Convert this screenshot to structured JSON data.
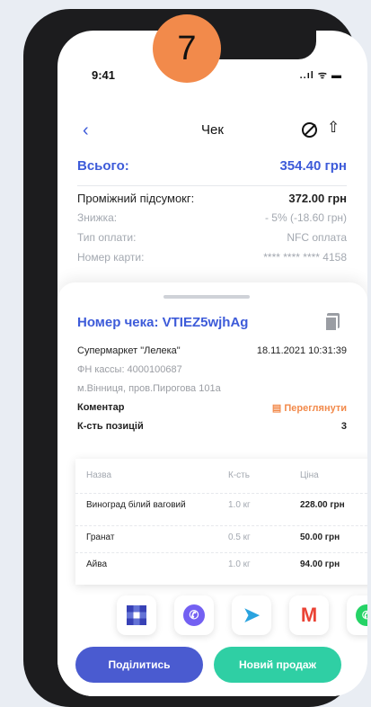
{
  "step_badge": "7",
  "status_bar": {
    "time": "9:41",
    "icons": "..ıl ᯤ ▬"
  },
  "nav": {
    "back_icon": "‹",
    "title": "Чек",
    "share_icon": "⇧"
  },
  "summary": {
    "total_label": "Всього:",
    "total_value": "354.40 грн",
    "subtotal_label": "Проміжний підсумокг:",
    "subtotal_value": "372.00 грн",
    "discount_label": "Знижка:",
    "discount_value": "- 5% (-18.60 грн)",
    "payment_label": "Тип оплати:",
    "payment_value": "NFC оплата",
    "card_label": "Номер карти:",
    "card_value": "**** **** **** 4158"
  },
  "receipt": {
    "title": "Номер чека: VTIEZ5wjhAg",
    "store": "Супермаркет \"Лелека\"",
    "datetime": "18.11.2021 10:31:39",
    "fiscal": "ФН кассы: 4000100687",
    "address": "м.Вінниця, пров.Пирогова 101а",
    "comment_label": "Коментар",
    "comment_action": "Переглянути",
    "positions_label": "К-сть позицій",
    "positions_value": "3"
  },
  "table": {
    "headers": [
      "Назва",
      "К-сть",
      "Ціна"
    ],
    "rows": [
      {
        "name": "Виноград білий ваговий",
        "qty": "1.0 кг",
        "price": "228.00 грн"
      },
      {
        "name": "Гранат",
        "qty": "0.5 кг",
        "price": "50.00 грн"
      },
      {
        "name": "Айва",
        "qty": "1.0 кг",
        "price": "94.00 грн"
      }
    ]
  },
  "share_targets": [
    "qr-code",
    "viber",
    "telegram",
    "gmail",
    "whatsapp"
  ],
  "buttons": {
    "share": "Поділитись",
    "new_sale": "Новий продаж"
  },
  "colors": {
    "primary": "#3d5bd9",
    "accent": "#f28a4b",
    "green": "#2fcfa4"
  }
}
